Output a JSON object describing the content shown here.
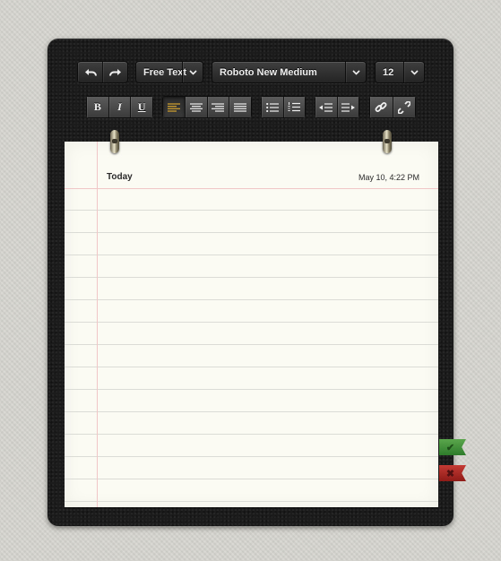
{
  "toolbar": {
    "undo_icon": "undo-arrow-icon",
    "redo_icon": "redo-arrow-icon",
    "text_style": "Free Text",
    "font_name": "Roboto New Medium",
    "font_size": "12",
    "bold_label": "B",
    "italic_label": "I",
    "underline_label": "U",
    "alignment_selected": "left",
    "accent_color": "#d5a430"
  },
  "note": {
    "title": "Today",
    "date": "May 10, 4:22 PM"
  },
  "actions": {
    "confirm_icon": "checkmark-icon",
    "confirm_color": "#3f8f39",
    "cancel_icon": "x-mark-icon",
    "cancel_color": "#a8231f"
  }
}
